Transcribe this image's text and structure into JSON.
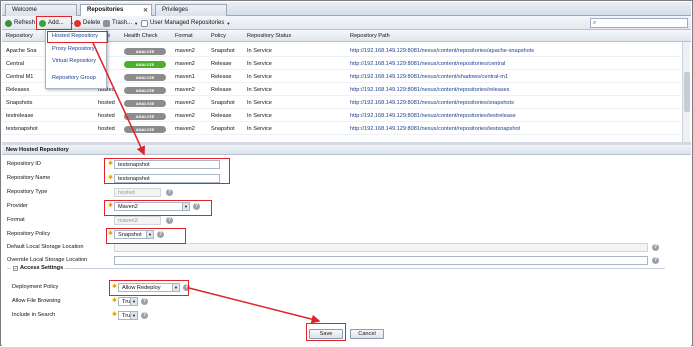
{
  "tabs": [
    {
      "label": "Welcome",
      "active": false
    },
    {
      "label": "Repositories",
      "active": true
    },
    {
      "label": "Privileges",
      "active": false
    }
  ],
  "toolbar": {
    "refresh": "Refresh",
    "add": "Add...",
    "delete": "Delete",
    "trash": "Trash...",
    "user_managed": "User Managed Repositories",
    "search_placeholder": ""
  },
  "add_menu": {
    "items": [
      "Hosted Repository",
      "Proxy Repository",
      "Virtual Repository",
      "Repository Group"
    ]
  },
  "grid": {
    "headers": [
      "Repository",
      "Type",
      "Health Check",
      "Format",
      "Policy",
      "Repository Status",
      "Repository Path"
    ],
    "rows": [
      {
        "name": "Apache Sna",
        "type": "",
        "health": "ANALYZE",
        "health_state": "gray",
        "format": "maven2",
        "policy": "Snapshot",
        "status": "In Service",
        "path": "http://192.168.149.129:8081/nexus/content/repositories/apache-snapshots"
      },
      {
        "name": "Central",
        "type": "",
        "health": "ANALYZE",
        "health_state": "green",
        "format": "maven2",
        "policy": "Release",
        "status": "In Service",
        "path": "http://192.168.149.129:8081/nexus/content/repositories/central"
      },
      {
        "name": "Central M1",
        "type": "",
        "health": "ANALYZE",
        "health_state": "gray",
        "format": "maven1",
        "policy": "Release",
        "status": "In Service",
        "path": "http://192.168.149.129:8081/nexus/content/shadows/central-m1"
      },
      {
        "name": "Releases",
        "type": "hosted",
        "health": "ANALYZE",
        "health_state": "gray",
        "format": "maven2",
        "policy": "Release",
        "status": "In Service",
        "path": "http://192.168.149.129:8081/nexus/content/repositories/releases"
      },
      {
        "name": "Snapshots",
        "type": "hosted",
        "health": "ANALYZE",
        "health_state": "gray",
        "format": "maven2",
        "policy": "Snapshot",
        "status": "In Service",
        "path": "http://192.168.149.129:8081/nexus/content/repositories/snapshots"
      },
      {
        "name": "testrelease",
        "type": "hosted",
        "health": "ANALYZE",
        "health_state": "gray",
        "format": "maven2",
        "policy": "Release",
        "status": "In Service",
        "path": "http://192.168.149.129:8081/nexus/content/repositories/testrelease"
      },
      {
        "name": "testsnapshot",
        "type": "hosted",
        "health": "ANALYZE",
        "health_state": "gray",
        "format": "maven2",
        "policy": "Snapshot",
        "status": "In Service",
        "path": "http://192.168.149.129:8081/nexus/content/repositories/testsnapshot"
      }
    ]
  },
  "form": {
    "title": "New Hosted Repository",
    "repo_id_label": "Repository ID",
    "repo_id_value": "testsnapshot",
    "repo_name_label": "Repository Name",
    "repo_name_value": "testsnapshot",
    "repo_type_label": "Repository Type",
    "repo_type_value": "hosted",
    "provider_label": "Provider",
    "provider_value": "Maven2",
    "format_label": "Format",
    "format_value": "maven2",
    "policy_label": "Repository Policy",
    "policy_value": "Snapshot",
    "storage_label": "Default Local Storage Location",
    "override_label": "Override Local Storage Location",
    "access_title": "Access Settings",
    "deploy_label": "Deployment Policy",
    "deploy_value": "Allow Redeploy",
    "browse_label": "Allow File Browsing",
    "browse_value": "True",
    "search_label": "Include in Search",
    "search_value": "True",
    "save": "Save",
    "cancel": "Cancel"
  },
  "colors": {
    "highlight": "#e0232b",
    "link": "#1a3f8f",
    "health_green": "#4caf2c",
    "health_gray": "#8c8c8c"
  }
}
